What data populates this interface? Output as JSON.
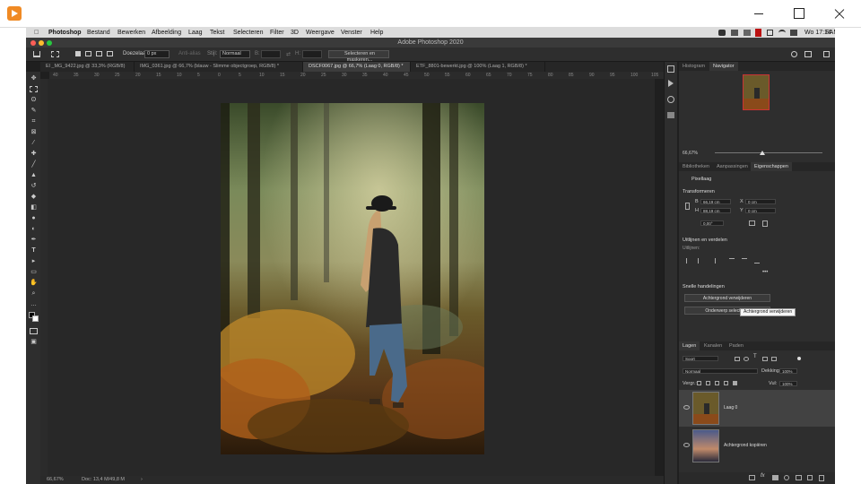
{
  "menubar": {
    "app": "Photoshop",
    "items": [
      "Bestand",
      "Bewerken",
      "Afbeelding",
      "Laag",
      "Tekst",
      "Selecteren",
      "Filter",
      "3D",
      "Weergave",
      "Venster",
      "Help"
    ],
    "clock": "Wo 17:14",
    "user": "EAM"
  },
  "ps_title": "Adobe Photoshop 2020",
  "options": {
    "doezelaar_label": "Doezelaar:",
    "doezelaar_value": "0 px",
    "anti_alias": "Anti-alias",
    "stijl_label": "Stijl:",
    "stijl_value": "Normaal",
    "b_label": "B:",
    "h_label": "H:",
    "select_mask": "Selecteren en maskeren..."
  },
  "doc_tabs": [
    {
      "label": "El _MG_9422.jpg @ 33,3% (RGB/8)"
    },
    {
      "label": "IMG_0361.jpg @ 66,7% (blauw - Slimme objectgroep, RGB/8) *"
    },
    {
      "label": "DSCF0067.jpg @ 66,7% (Laag 0, RGB/8) *"
    },
    {
      "label": "ETF_8801-bewerkt.jpg @ 100% (Laag 1, RGB/8) *"
    }
  ],
  "ruler_top": [
    "40",
    "35",
    "30",
    "25",
    "20",
    "15",
    "10",
    "5",
    "0",
    "5",
    "10",
    "15",
    "20",
    "25",
    "30",
    "35",
    "40",
    "45",
    "50",
    "55",
    "60",
    "65",
    "70",
    "75",
    "80",
    "85",
    "90",
    "95",
    "100",
    "105"
  ],
  "status": {
    "zoom": "66,67%",
    "doc": "Doc: 13,4 M/49,8 M"
  },
  "panels": {
    "top_tabs": [
      "Histogram",
      "Navigator"
    ],
    "nav_zoom": "66,67%",
    "mid_tabs": [
      "Bibliotheken",
      "Aanpassingen",
      "Eigenschappen"
    ],
    "pixel_layer": "Pixellaag",
    "transform_title": "Transformeren",
    "b_label": "B",
    "b_value": "66,19 cm",
    "h_label": "H",
    "h_value": "88,19 cm",
    "x_label": "X",
    "x_value": "0 cm",
    "y_label": "Y",
    "y_value": "0 cm",
    "angle_value": "0,00°",
    "align_title": "Uitlijnen en verdelen",
    "align_sub": "Uitlijnen:",
    "quick_title": "Snelle handelingen",
    "remove_bg": "Achtergrond verwijderen",
    "select_subject": "Onderwerp selecteren",
    "tooltip": "Achtergrond verwijderen",
    "layer_tabs": [
      "Lagen",
      "Kanalen",
      "Paden"
    ],
    "kind": "Soort",
    "blend": "Normaal",
    "opacity_label": "Dekking:",
    "opacity_value": "100%",
    "lock_label": "Vergr.:",
    "fill_label": "Vul:",
    "fill_value": "100%",
    "layers": [
      {
        "name": "Laag 0"
      },
      {
        "name": "Achtergrond kopiëren"
      }
    ]
  }
}
